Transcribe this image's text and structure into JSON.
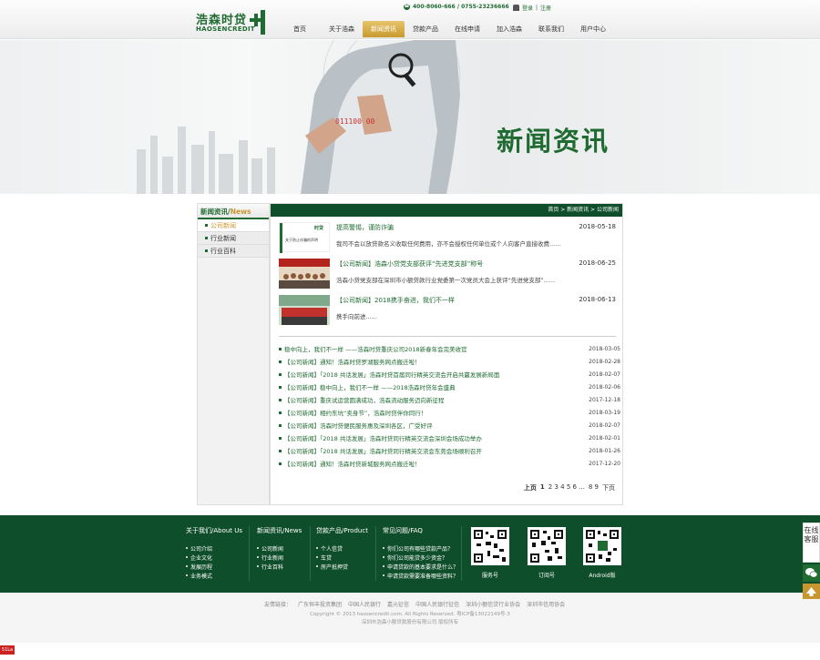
{
  "header": {
    "logo_cn": "浩森时贷",
    "logo_en": "HAOSENCREDIT",
    "phone": "400-8060-666 / 0755-23236666",
    "login": "登录",
    "register": "注册",
    "nav": [
      "首页",
      "关于浩森",
      "新闻资讯",
      "贷款产品",
      "在线申请",
      "加入浩森",
      "联系我们",
      "用户中心"
    ],
    "nav_active": "新闻资讯"
  },
  "banner": {
    "title": "新闻资讯",
    "screen_text": "011100 00"
  },
  "sidebar": {
    "title_cn": "新闻资讯/",
    "title_en": "News",
    "items": [
      "公司新闻",
      "行业新闻",
      "行业百科"
    ],
    "active": "公司新闻"
  },
  "breadcrumb": "首页 > 新闻资讯 > 公司新闻",
  "featured": [
    {
      "title": "提高警惕，谨防诈骗",
      "date": "2018-05-18",
      "desc": "我司不会以放贷款名义收取任何费用，亦不会授权任何单位或个人向客户直接收费......",
      "thumb_label": "关于防止诈骗的声明"
    },
    {
      "title": "【公司新闻】浩森小贷党支部获评“先进党支部”称号",
      "date": "2018-06-25",
      "desc": "浩森小贷党支部在深圳市小额贷款行业党委第一次党员大会上获评“先进党支部”......"
    },
    {
      "title": "【公司新闻】2018携手奋进，我们不一样",
      "date": "2018-06-13",
      "desc": "携手向前进......"
    }
  ],
  "news": [
    {
      "title": "稳中向上，我们不一样 ——浩森时贷重庆公司2018新春年会完美收官",
      "date": "2018-03-05"
    },
    {
      "title": "【公司新闻】通知！浩森时贷罗湖服务网点搬迁啦！",
      "date": "2018-02-28"
    },
    {
      "title": "【公司新闻】「2018 共话发展」浩森时贷首届同行精英交流会开启共赢发展新局面",
      "date": "2018-02-07"
    },
    {
      "title": "【公司新闻】稳中向上，我们不一样 ——2018浩森时贷年会盛典",
      "date": "2018-02-06"
    },
    {
      "title": "【公司新闻】重庆试运营圆满成功，浩森流动服务迈向新征程",
      "date": "2017-12-18"
    },
    {
      "title": "【公司新闻】相约东坑“卖身节”，浩森时贷伴你同行！",
      "date": "2018-03-19"
    },
    {
      "title": "【公司新闻】浩森时贷便民服务惠及深圳各区，广受好评",
      "date": "2018-02-07"
    },
    {
      "title": "【公司新闻】「2018 共话发展」浩森时贷同行精英交流会深圳会场成功举办",
      "date": "2018-02-01"
    },
    {
      "title": "【公司新闻】「2018 共话发展」浩森时贷同行精英交流会东莞会场顺利召开",
      "date": "2018-01-26"
    },
    {
      "title": "【公司新闻】通知！浩森时贷新城服务网点搬迁啦！",
      "date": "2017-12-20"
    }
  ],
  "pager": {
    "prev": "上页",
    "current": "1",
    "pages": "2 3 4 5 6 ...",
    "pages_tail": "8 9",
    "next": "下页"
  },
  "footer": {
    "cols": [
      {
        "title": "关于我们/About Us",
        "items": [
          "公司介绍",
          "企业文化",
          "发展历程",
          "业务模式"
        ]
      },
      {
        "title": "新闻资讯/News",
        "items": [
          "公司新闻",
          "行业新闻",
          "行业百科"
        ]
      },
      {
        "title": "贷款产品/Product",
        "items": [
          "个人信贷",
          "车贷",
          "房产抵押贷"
        ]
      },
      {
        "title": "常见问题/FAQ",
        "items": [
          "你们公司有哪些贷款产品？",
          "你们公司能贷多少资金？",
          "申请贷款的基本要求是什么？",
          "申请贷款需要准备哪些资料？"
        ]
      }
    ],
    "qr": [
      "服务号",
      "订阅号",
      "Android版"
    ]
  },
  "bottom": {
    "links_label": "友情链接：",
    "links": [
      "广东恒丰投资集团",
      "中国人民银行",
      "嘉元征信",
      "中国人民银行征信",
      "深圳小额信贷行业协会",
      "深圳市信用协会"
    ],
    "copyright": "Copyright © 2013 haosencredit.com. All Rights Reserved. 粤ICP备13022149号-3",
    "company": "深圳市浩森小额贷款股份有限公司 版权所有"
  },
  "float": {
    "service": "在线客服"
  },
  "stat_badge": "51La",
  "colors": {
    "brand_green": "#1f6b32",
    "dark_green": "#0f4e2b",
    "gold": "#c8962e"
  }
}
